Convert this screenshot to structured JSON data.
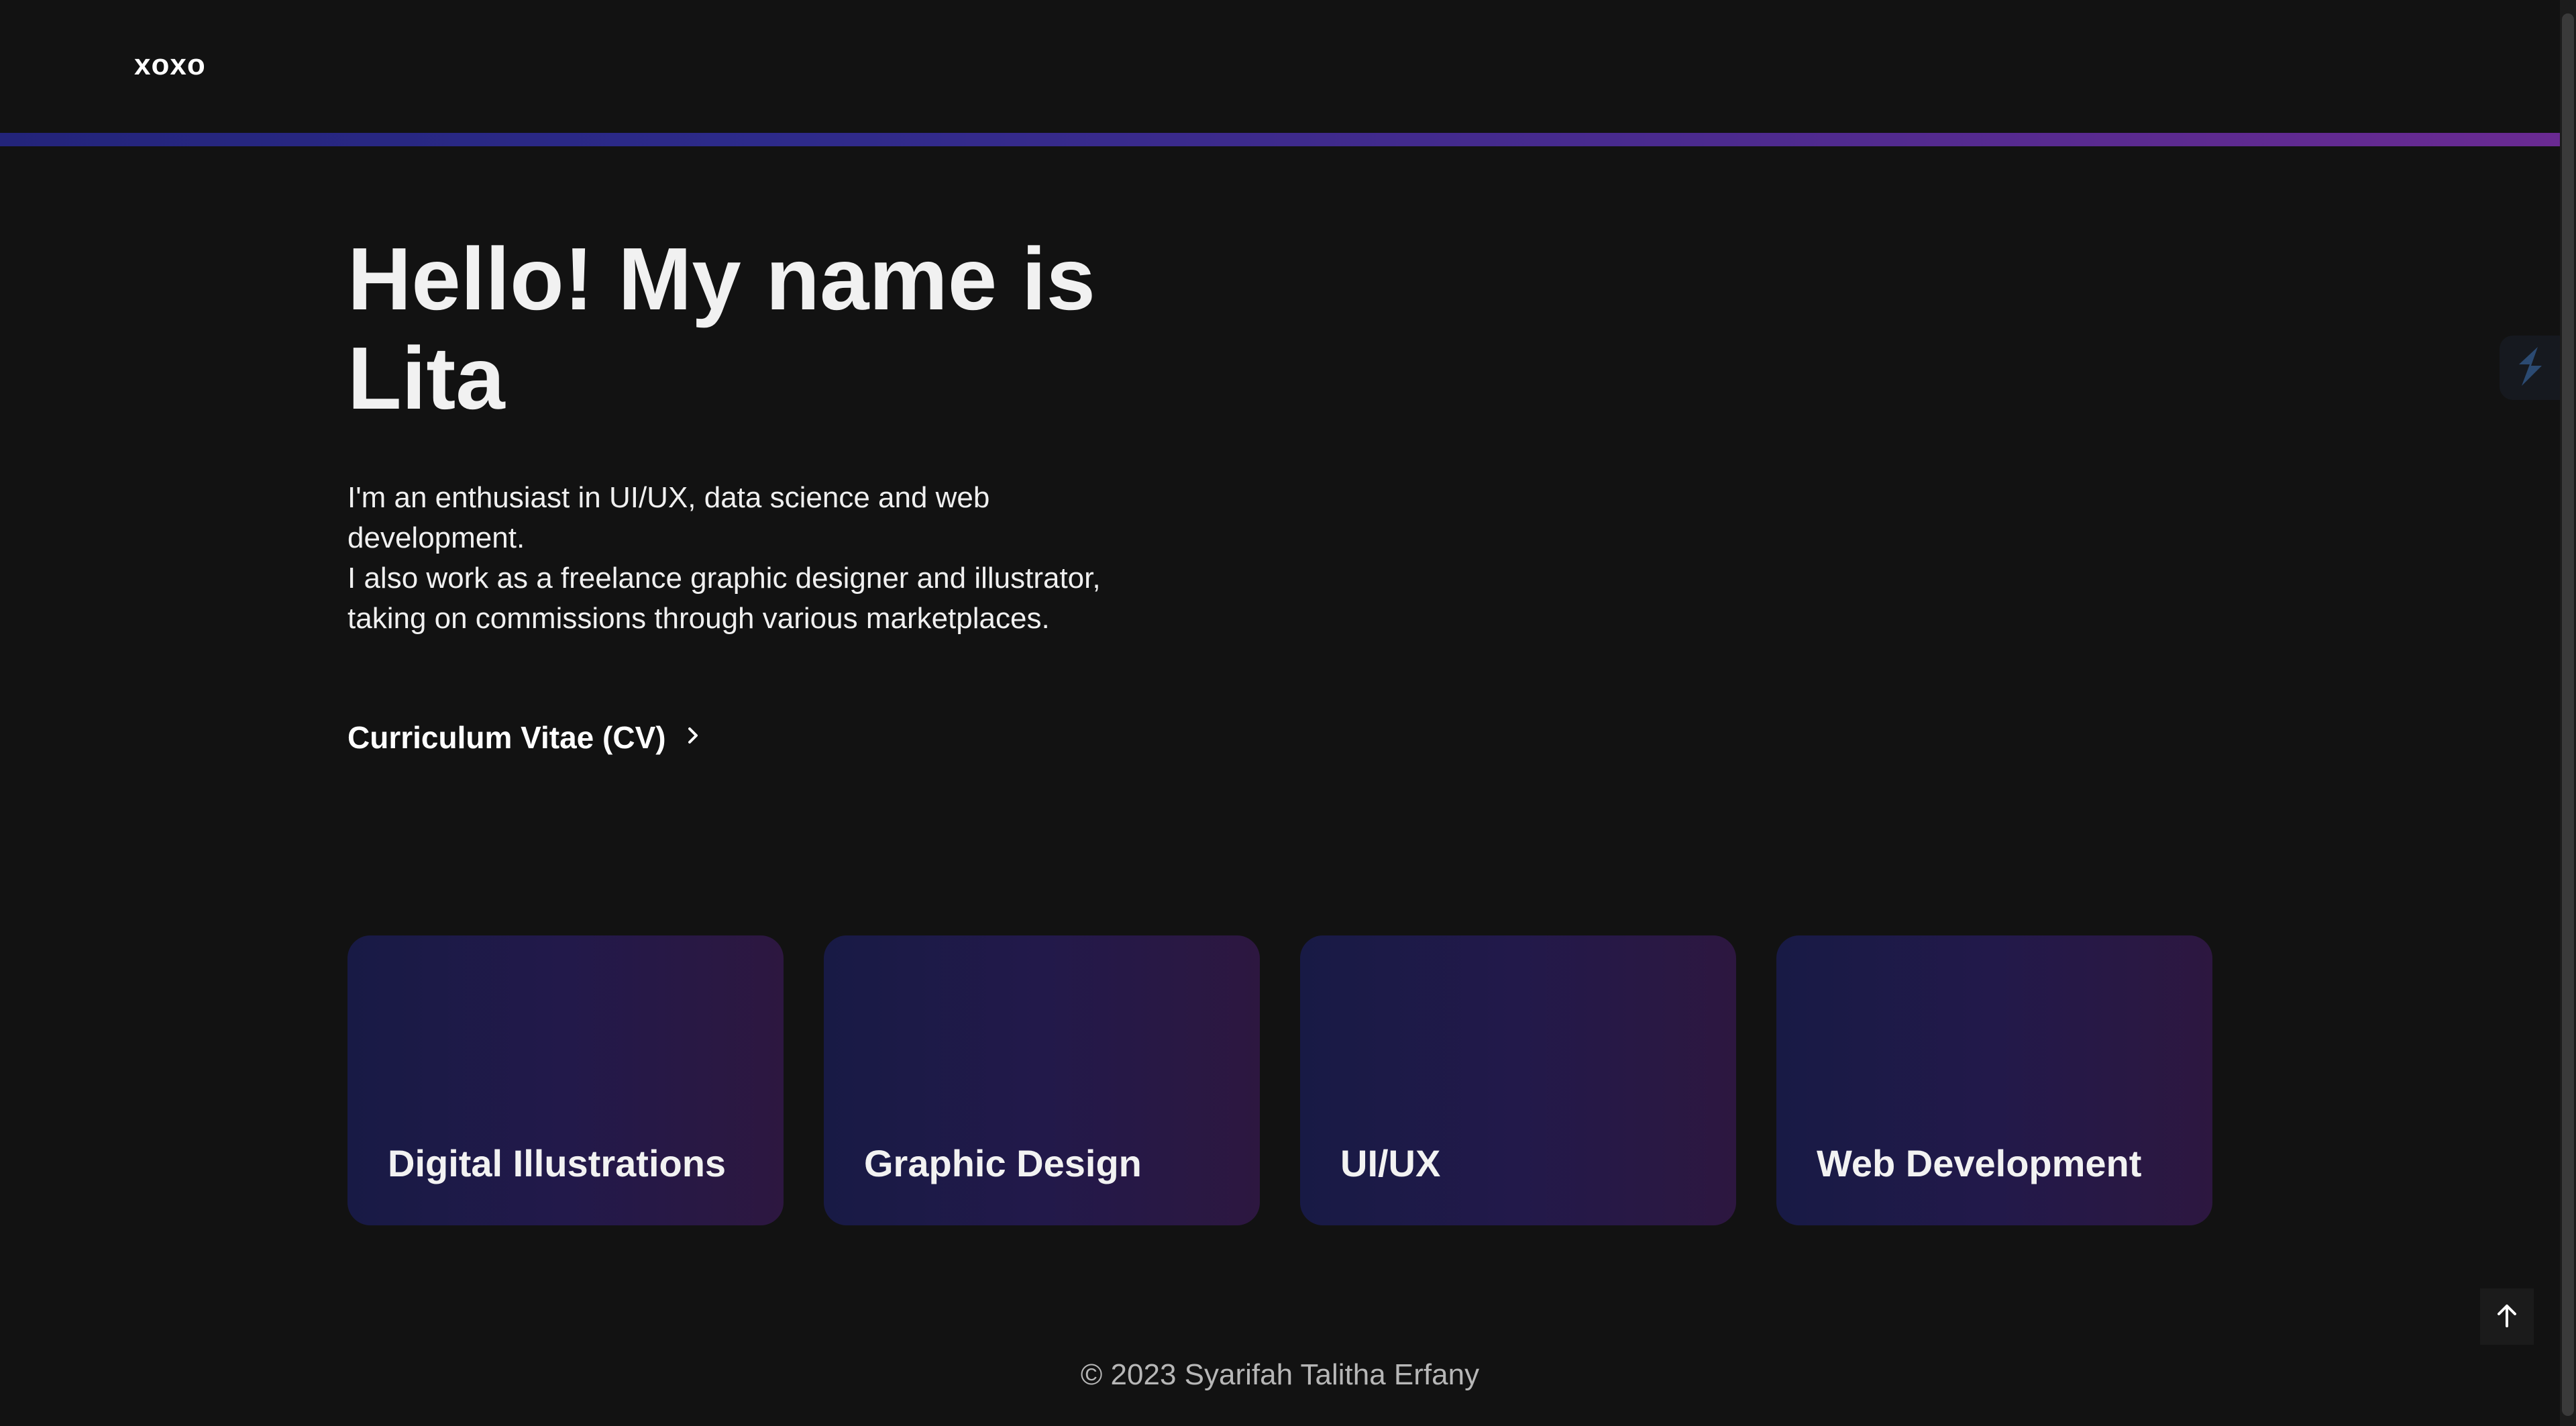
{
  "header": {
    "logo_text": "xoxo"
  },
  "hero": {
    "title": "Hello! My name is Lita",
    "description_line_1": "I'm an enthusiast in UI/UX, data science and web development.",
    "description_line_2": "I also work as a freelance graphic designer and illustrator, taking on commissions through various marketplaces.",
    "cv_link_label": "Curriculum Vitae (CV)",
    "cv_link_icon": "chevron-right-icon"
  },
  "cards": [
    {
      "label": "Digital Illustrations"
    },
    {
      "label": "Graphic Design"
    },
    {
      "label": "UI/UX"
    },
    {
      "label": "Web Development"
    }
  ],
  "widgets": {
    "side_widget_icon": "lightning-icon",
    "back_to_top_icon": "arrow-up-icon"
  },
  "footer": {
    "copyright": "© 2023 Syarifah Talitha Erfany"
  },
  "colors": {
    "background": "#121212",
    "accent_gradient_start": "#23247a",
    "accent_gradient_end": "#6a2a92",
    "card_gradient_start": "#181a45",
    "card_gradient_end": "#2d1740"
  }
}
